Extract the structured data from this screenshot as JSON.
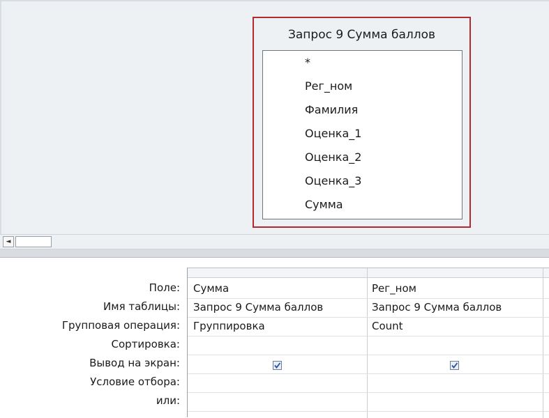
{
  "table": {
    "title": "Запрос 9 Сумма баллов",
    "fields": [
      "*",
      "Рег_ном",
      "Фамилия",
      "Оценка_1",
      "Оценка_2",
      "Оценка_3",
      "Сумма"
    ]
  },
  "scroll": {
    "left_arrow": "◄"
  },
  "grid": {
    "row_labels": [
      "Поле:",
      "Имя таблицы:",
      "Групповая операция:",
      "Сортировка:",
      "Вывод на экран:",
      "Условие отбора:",
      "или:"
    ],
    "columns": [
      {
        "field": "Сумма",
        "table": "Запрос 9 Сумма баллов",
        "group": "Группировка",
        "sort": "",
        "show": true,
        "criteria": "",
        "or": ""
      },
      {
        "field": "Рег_ном",
        "table": "Запрос 9 Сумма баллов",
        "group": "Count",
        "sort": "",
        "show": true,
        "criteria": "",
        "or": ""
      }
    ]
  }
}
